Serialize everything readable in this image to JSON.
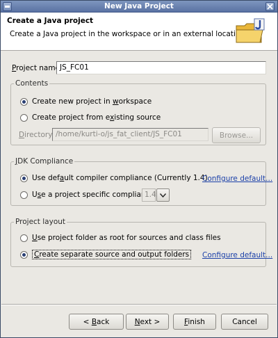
{
  "window": {
    "title": "New Java Project"
  },
  "header": {
    "title": "Create a Java project",
    "description": "Create a Java project in the workspace or in an external location.",
    "icon": "java-project-folder-icon"
  },
  "project_name": {
    "label": "Project name:",
    "value": "JS_FC01"
  },
  "contents": {
    "label": "Contents",
    "option_workspace": "Create new project in workspace",
    "option_existing": "Create project from existing source",
    "selected": "workspace",
    "directory_label": "Directory:",
    "directory_value": "/home/kurti-o/js_fat_client/JS_FC01",
    "browse_label": "Browse..."
  },
  "jdk": {
    "label": "JDK Compliance",
    "option_default": "Use default compiler compliance (Currently 1.4)",
    "option_specific": "Use a project specific compliance:",
    "selected": "default",
    "compliance_value": "1.4",
    "configure_link": "Configure default..."
  },
  "layout": {
    "label": "Project layout",
    "option_root": "Use project folder as root for sources and class files",
    "option_separate": "Create separate source and output folders",
    "selected": "separate",
    "configure_link": "Configure default..."
  },
  "buttons": {
    "back": "< Back",
    "next": "Next >",
    "finish": "Finish",
    "cancel": "Cancel"
  },
  "colors": {
    "titlebar": "#6f87b4",
    "link": "#1a3fa8",
    "dialog_bg": "#eae8e3"
  }
}
